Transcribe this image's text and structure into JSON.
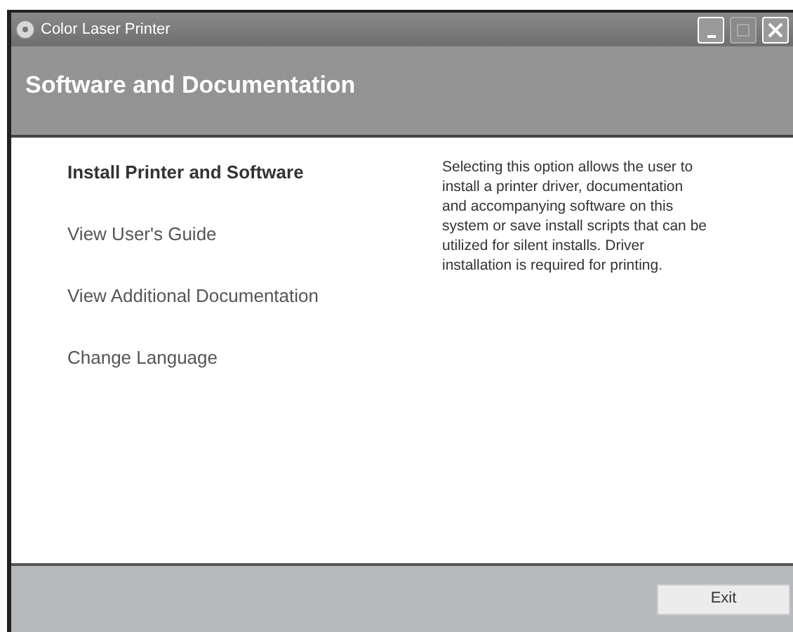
{
  "window": {
    "title": "Color Laser Printer"
  },
  "header": {
    "title": "Software and Documentation"
  },
  "menu": [
    {
      "label": "Install Printer and Software",
      "selected": true
    },
    {
      "label": "View User's Guide",
      "selected": false
    },
    {
      "label": "View Additional Documentation",
      "selected": false
    },
    {
      "label": "Change Language",
      "selected": false
    }
  ],
  "description": "Selecting this option allows the user to install a printer driver, documentation and accompanying software on this system or save install scripts that can be utilized for silent installs. Driver installation is required for printing.",
  "buttons": [
    "Exit"
  ]
}
